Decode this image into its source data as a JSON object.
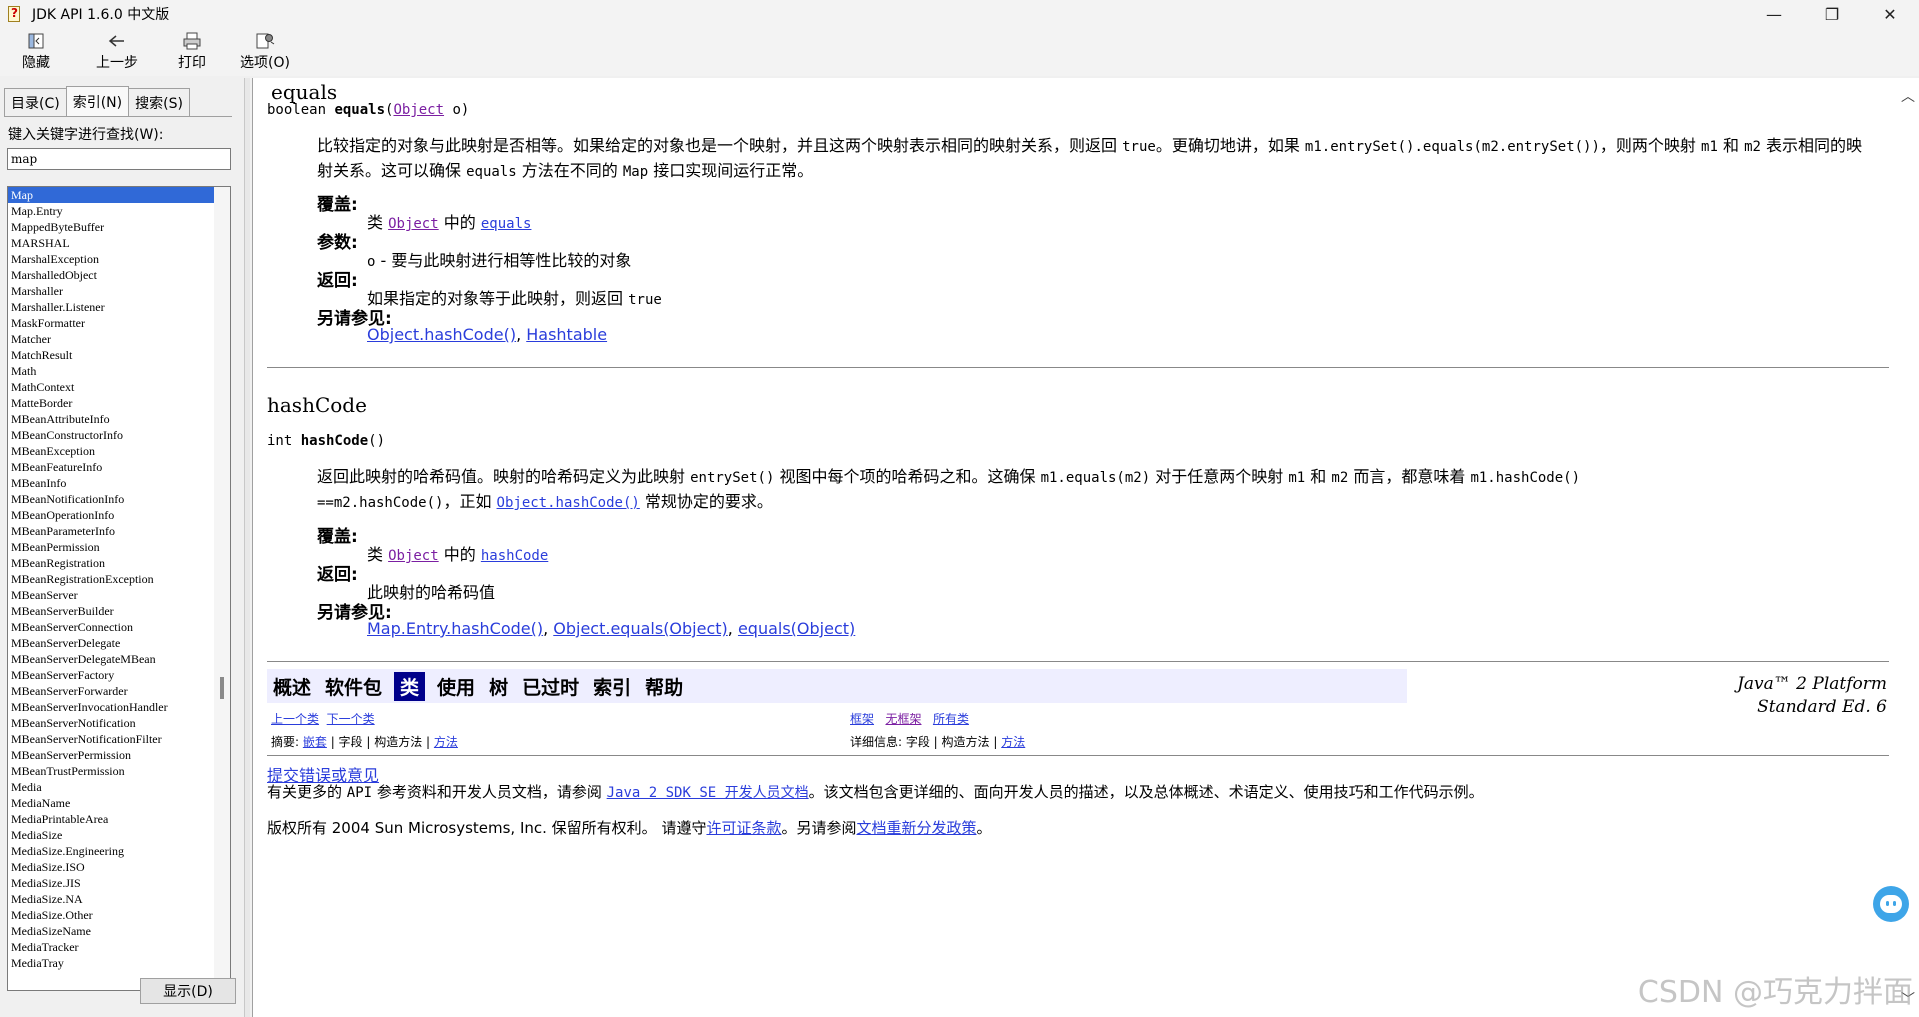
{
  "window": {
    "title": "JDK API 1.6.0 中文版",
    "controls": {
      "minimize": "—",
      "maximize": "❐",
      "close": "✕"
    }
  },
  "toolbar": {
    "hide_label": "隐藏",
    "back_label": "上一步",
    "print_label": "打印",
    "options_label": "选项(O)"
  },
  "leftpane": {
    "tabs": [
      {
        "label": "目录(C)"
      },
      {
        "label": "索引(N)"
      },
      {
        "label": "搜索(S)"
      }
    ],
    "search_label": "键入关键字进行查找(W):",
    "search_value": "map",
    "items": [
      "Map",
      "Map.Entry",
      "MappedByteBuffer",
      "MARSHAL",
      "MarshalException",
      "MarshalledObject",
      "Marshaller",
      "Marshaller.Listener",
      "MaskFormatter",
      "Matcher",
      "MatchResult",
      "Math",
      "MathContext",
      "MatteBorder",
      "MBeanAttributeInfo",
      "MBeanConstructorInfo",
      "MBeanException",
      "MBeanFeatureInfo",
      "MBeanInfo",
      "MBeanNotificationInfo",
      "MBeanOperationInfo",
      "MBeanParameterInfo",
      "MBeanPermission",
      "MBeanRegistration",
      "MBeanRegistrationException",
      "MBeanServer",
      "MBeanServerBuilder",
      "MBeanServerConnection",
      "MBeanServerDelegate",
      "MBeanServerDelegateMBean",
      "MBeanServerFactory",
      "MBeanServerForwarder",
      "MBeanServerInvocationHandler",
      "MBeanServerNotification",
      "MBeanServerNotificationFilter",
      "MBeanServerPermission",
      "MBeanTrustPermission",
      "Media",
      "MediaName",
      "MediaPrintableArea",
      "MediaSize",
      "MediaSize.Engineering",
      "MediaSize.ISO",
      "MediaSize.JIS",
      "MediaSize.NA",
      "MediaSize.Other",
      "MediaSizeName",
      "MediaTracker",
      "MediaTray"
    ],
    "display_button": "显示(D)"
  },
  "content": {
    "equals": {
      "heading": "equals",
      "sig_type": "boolean ",
      "sig_name": "equals",
      "sig_open": "(",
      "sig_param_type": "Object",
      "sig_rest": " o)",
      "desc1": "比较指定的对象与此映射是否相等。如果给定的对象也是一个映射，并且这两个映射表示相同的映射关系，则返回 ",
      "desc_true": "true",
      "desc2": "。更确切地讲，如果 ",
      "desc_code1": "m1.entrySet().equals(m2.entrySet())",
      "desc3": "，则两个映射 ",
      "desc_m1": "m1",
      "desc4": " 和 ",
      "desc_m2": "m2",
      "desc5": " 表示相同的映射关系。这可以确保 ",
      "desc_equals": "equals",
      "desc6": " 方法在不同的 ",
      "desc_map": "Map",
      "desc7": " 接口实现间运行正常。",
      "overrides_label": "覆盖:",
      "overrides_pre": "类 ",
      "overrides_class": "Object",
      "overrides_mid": " 中的 ",
      "overrides_method": "equals",
      "params_label": "参数:",
      "param_name": "o",
      "param_desc": " - 要与此映射进行相等性比较的对象",
      "returns_label": "返回:",
      "returns_text": "如果指定的对象等于此映射，则返回 ",
      "returns_true": "true",
      "seealso_label": "另请参见:",
      "seealso_1": "Object.hashCode()",
      "seealso_sep": ", ",
      "seealso_2": "Hashtable"
    },
    "hashcode": {
      "heading": "hashCode",
      "sig_type": "int ",
      "sig_name": "hashCode",
      "sig_rest": "()",
      "desc1": "返回此映射的哈希码值。映射的哈希码定义为此映射 ",
      "desc_entryset": "entrySet()",
      "desc2": " 视图中每个项的哈希码之和。这确保 ",
      "desc_code1": "m1.equals(m2)",
      "desc3": " 对于任意两个映射 ",
      "desc_m1": "m1",
      "desc4": " 和 ",
      "desc_m2": "m2",
      "desc5": " 而言，都意味着 ",
      "desc_code2a": "m1.hashCode()",
      "desc_code2b": "==m2.hashCode()",
      "desc6": "，正如 ",
      "desc_link": "Object.hashCode()",
      "desc7": " 常规协定的要求。",
      "overrides_label": "覆盖:",
      "overrides_pre": "类 ",
      "overrides_class": "Object",
      "overrides_mid": " 中的 ",
      "overrides_method": "hashCode",
      "returns_label": "返回:",
      "returns_text": "此映射的哈希码值",
      "seealso_label": "另请参见:",
      "seealso_1": "Map.Entry.hashCode()",
      "seealso_2": "Object.equals(Object)",
      "seealso_3": "equals(Object)",
      "seealso_sep": ", "
    },
    "navbar": {
      "items": [
        "概述",
        "软件包",
        "类",
        "使用",
        "树",
        "已过时",
        "索引",
        "帮助"
      ],
      "platform_line1": "Java™ 2 Platform",
      "platform_line2": "Standard Ed. 6"
    },
    "subnav": {
      "prev_class": "上一个类",
      "next_class": "下一个类",
      "frames": "框架",
      "no_frames": "无框架",
      "all_classes": "所有类",
      "summary_label": "摘要: ",
      "summary_nested": "嵌套",
      "summary_field": " | 字段 | 构造方法 | ",
      "summary_method": "方法",
      "detail_label": "详细信息: ",
      "detail_field": " 字段 | 构造方法 | ",
      "detail_method": "方法"
    },
    "footer": {
      "bug_link": "提交错误或意见",
      "more_1": "有关更多的 ",
      "more_api": "API",
      "more_2": " 参考资料和开发人员文档，请参阅 ",
      "more_link": "Java 2 SDK SE 开发人员文档",
      "more_3": "。该文档包含更详细的、面向开发人员的描述，以及总体概述、术语定义、使用技巧和工作代码示例。",
      "copy_1": "版权所有 2004 Sun Microsystems, Inc. 保留所有权利。 请遵守",
      "copy_link1": "许可证条款",
      "copy_2": "。另请参阅",
      "copy_link2": "文档重新分发政策",
      "copy_3": "。"
    }
  },
  "watermark": "CSDN @巧克力拌面"
}
